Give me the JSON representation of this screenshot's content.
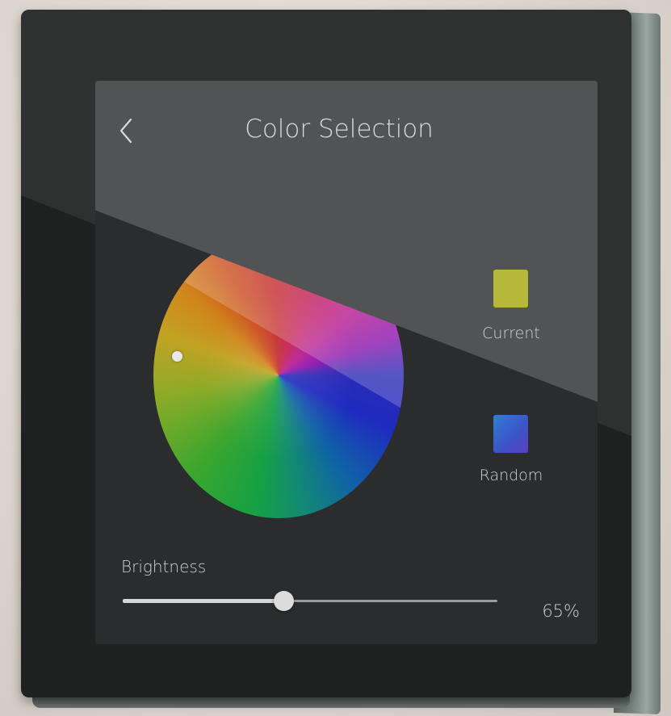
{
  "header": {
    "title": "Color Selection",
    "back_icon": "chevron-left-icon"
  },
  "color_wheel": {
    "selected_color": "#b5b83a"
  },
  "swatches": {
    "current": {
      "label": "Current",
      "color": "#b5b83a"
    },
    "random": {
      "label": "Random",
      "color": "#3a55c6"
    }
  },
  "brightness": {
    "label": "Brightness",
    "value": 65,
    "value_text": "65%"
  }
}
